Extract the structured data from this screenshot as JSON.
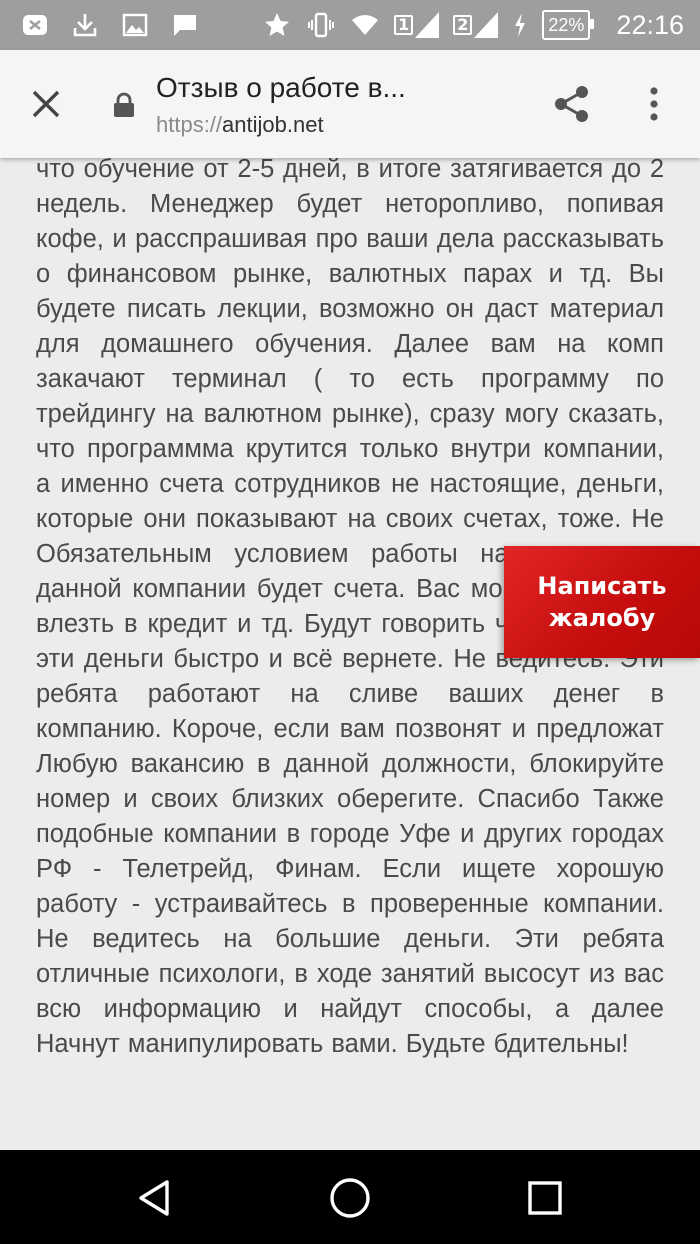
{
  "status_bar": {
    "icons_left": [
      "app-notification-icon",
      "download-icon",
      "image-icon",
      "message-icon"
    ],
    "icons_right": [
      "star-icon",
      "vibrate-icon",
      "wifi-icon",
      "sim1-signal-icon",
      "sim2-signal-icon",
      "charging-icon"
    ],
    "sim1_label": "1",
    "sim2_label": "2",
    "battery": "22%",
    "time": "22:16"
  },
  "toolbar": {
    "title": "Отзыв о работе в...",
    "url_protocol": "https://",
    "url_host": "antijob.net"
  },
  "article": {
    "text": "что обучение от 2-5 дней, в итоге затягивается до 2 недель. Менеджер будет неторопливо, попивая кофе, и расспрашивая про ваши дела рассказывать о финансовом рынке, валютных парах и тд. Вы будете писать лекции, возможно он даст материал для домашнего обучения. Далее вам на комп закачают терминал ( то есть программу по трейдингу на валютном рынке), сразу могу сказать, что программма крутится только внутри компании, а именно счета сотрудников не настоящие, деньги, которые они показывают на своих счетах, тоже. Не Обязательным условием работы на позиции в данной компании будет счета. Вас могут заставить влезть в кредит и тд. Будут говорить что отыграете эти деньги быстро и всё вернете. Не ведитесь. Эти ребята работают на сливе ваших денег в компанию. Короче, если вам позвонят и предложат Любую вакансию в данной должности, блокируйте номер и своих близких оберегите. Спасибо Также подобные компании в городе Уфе и других городах РФ - Телетрейд, Финам. Если ищете хорошую работу - устраивайтесь в проверенные компании. Не ведитесь на большие деньги. Эти ребята отличные психологи, в ходе занятий высосут из вас всю информацию и найдут способы, а далее Начнут манипулировать вами. Будьте бдительны!"
  },
  "complaint_button": {
    "label": "Написать жалобу",
    "color": "#d11a1a"
  },
  "nav_bar": {
    "buttons": [
      "back-icon",
      "home-icon",
      "recents-icon"
    ]
  }
}
